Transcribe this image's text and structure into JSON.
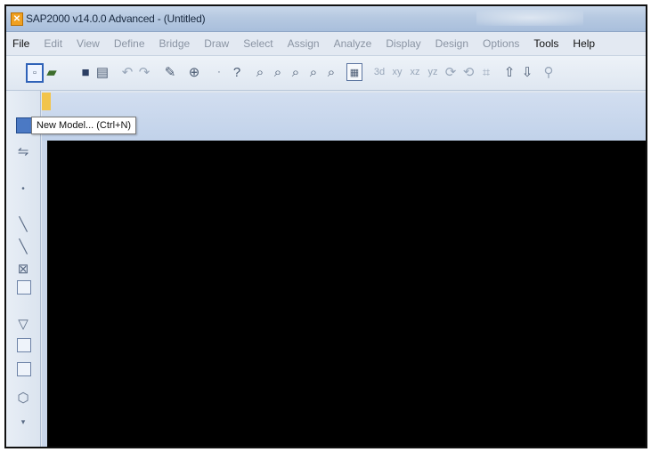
{
  "window": {
    "title": "SAP2000 v14.0.0 Advanced  - (Untitled)"
  },
  "menu": {
    "items": [
      {
        "label": "File",
        "enabled": true
      },
      {
        "label": "Edit",
        "enabled": false
      },
      {
        "label": "View",
        "enabled": false
      },
      {
        "label": "Define",
        "enabled": false
      },
      {
        "label": "Bridge",
        "enabled": false
      },
      {
        "label": "Draw",
        "enabled": false
      },
      {
        "label": "Select",
        "enabled": false
      },
      {
        "label": "Assign",
        "enabled": false
      },
      {
        "label": "Analyze",
        "enabled": false
      },
      {
        "label": "Display",
        "enabled": false
      },
      {
        "label": "Design",
        "enabled": false
      },
      {
        "label": "Options",
        "enabled": false
      },
      {
        "label": "Tools",
        "enabled": true
      },
      {
        "label": "Help",
        "enabled": true
      }
    ]
  },
  "toolbar": {
    "icons": [
      "new-model-icon",
      "open-icon",
      "save-icon",
      "print-icon",
      "undo-icon",
      "redo-icon",
      "pencil-icon",
      "lock-icon",
      "run-icon",
      "zoom-icon",
      "zoom-window-icon",
      "zoom-in-icon",
      "zoom-out-icon",
      "pan-icon",
      "view-3d-icon",
      "xy-view-icon",
      "xz-view-icon",
      "yz-view-icon",
      "rotate-icon",
      "perspective-icon",
      "up-icon",
      "down-icon",
      "snap-icon"
    ]
  },
  "tooltip": {
    "text": "New Model... (Ctrl+N)"
  }
}
